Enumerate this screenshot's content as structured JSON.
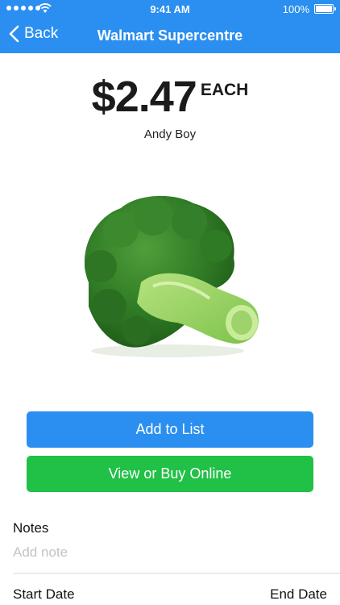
{
  "status_bar": {
    "time": "9:41 AM",
    "battery": "100%"
  },
  "nav": {
    "back_label": "Back",
    "title": "Walmart Supercentre"
  },
  "product": {
    "price": "$2.47",
    "unit": "EACH",
    "brand": "Andy Boy",
    "image_icon": "broccoli-image"
  },
  "actions": {
    "add_to_list": "Add to List",
    "view_or_buy": "View or Buy Online"
  },
  "notes": {
    "label": "Notes",
    "placeholder": "Add note",
    "value": ""
  },
  "dates": {
    "start_label": "Start Date",
    "end_label": "End Date"
  },
  "colors": {
    "nav_blue": "#2a8ff0",
    "add_button": "#2a8ff0",
    "buy_button": "#21c046"
  }
}
